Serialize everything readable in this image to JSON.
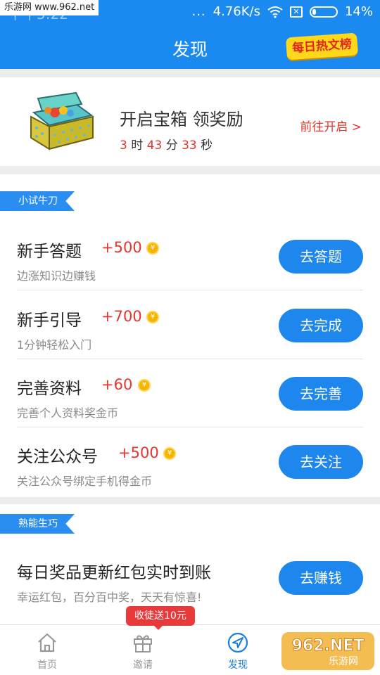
{
  "status_bar": {
    "time": "下午5:22",
    "watermark": "乐游网 www.962.net",
    "dots": "...",
    "speed": "4.76K/s",
    "sim_mark": "✕",
    "battery": "14%"
  },
  "header": {
    "title": "发现",
    "hot_badge": "每日热文榜"
  },
  "treasure": {
    "title": "开启宝箱 领奖励",
    "hours": "3",
    "hours_unit": "时",
    "minutes": "43",
    "minutes_unit": "分",
    "seconds": "33",
    "seconds_unit": "秒",
    "link": "前往开启 >"
  },
  "sections": [
    {
      "tag": "小试牛刀",
      "tasks": [
        {
          "name": "新手答题",
          "reward": "+500",
          "desc": "边涨知识边赚钱",
          "button": "去答题"
        },
        {
          "name": "新手引导",
          "reward": "+700",
          "desc": "1分钟轻松入门",
          "button": "去完成"
        },
        {
          "name": "完善资料",
          "reward": "+60",
          "desc": "完善个人资料奖金币",
          "button": "去完善"
        },
        {
          "name": "关注公众号",
          "reward": "+500",
          "desc": "关注公众号绑定手机得金币",
          "button": "去关注"
        }
      ]
    },
    {
      "tag": "熟能生巧",
      "tasks": [
        {
          "name": "每日奖品更新红包实时到账",
          "desc": "幸运红包，百分百中奖，天天有惊喜!",
          "button": "去赚钱"
        }
      ]
    }
  ],
  "coin_symbol": "¥",
  "nav": {
    "items": [
      {
        "label": "首页",
        "icon": "home-icon"
      },
      {
        "label": "邀请",
        "icon": "gift-icon"
      },
      {
        "label": "发现",
        "icon": "compass-icon"
      }
    ],
    "invite_badge": "收徒送10元",
    "logo_text": "962.NET",
    "logo_sub": "乐游网"
  },
  "colors": {
    "brand_blue": "#1b8af0",
    "accent_red": "#e5352e",
    "button_blue": "#1d87ee"
  }
}
